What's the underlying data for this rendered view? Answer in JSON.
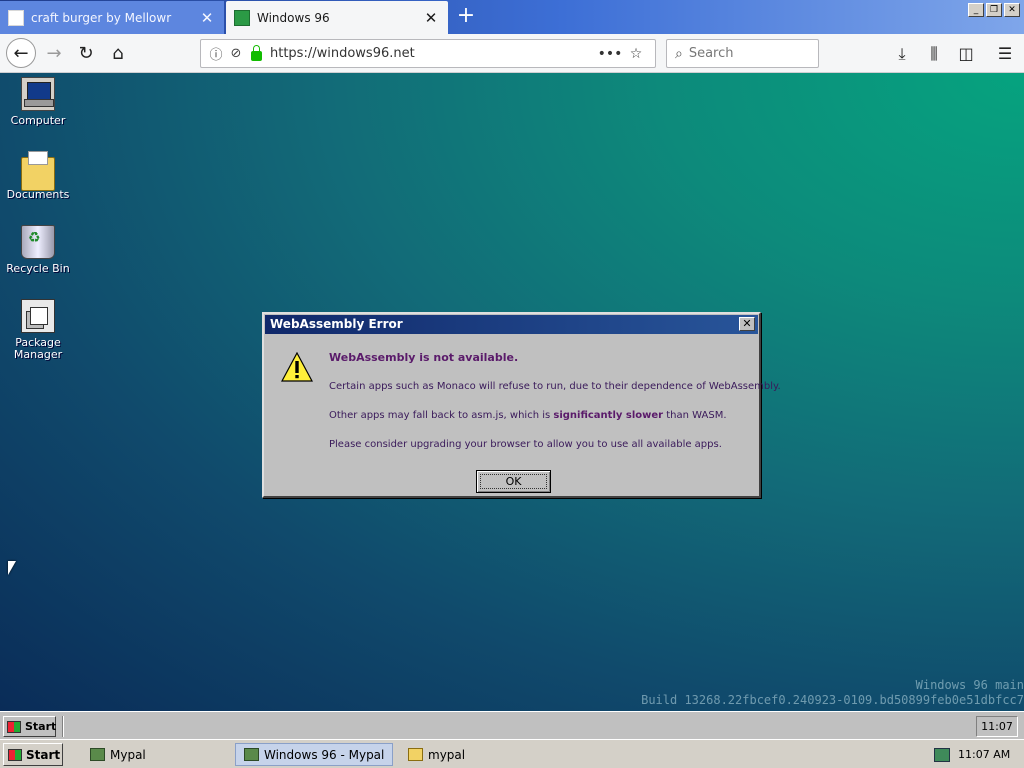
{
  "browser": {
    "tabs": [
      {
        "title": "craft burger by Mellowr",
        "active": false
      },
      {
        "title": "Windows 96",
        "active": true
      }
    ],
    "new_tab_symbol": "+",
    "close_symbol": "✕",
    "url": "https://windows96.net",
    "search_placeholder": "Search",
    "window_controls": [
      "_",
      "❐",
      "✕"
    ]
  },
  "desktop": {
    "icons": [
      {
        "label": "Computer",
        "icon": "computer-icon"
      },
      {
        "label": "Documents",
        "icon": "folder-icon"
      },
      {
        "label": "Recycle Bin",
        "icon": "recycle-bin-icon"
      },
      {
        "label": "Package Manager",
        "icon": "package-manager-icon"
      }
    ],
    "watermark_line1": "Windows 96 main",
    "watermark_line2": "Build 13268.22fbcef0.240923-0109.bd50899feb0e51dbfcc7"
  },
  "dialog": {
    "title": "WebAssembly Error",
    "heading": "WebAssembly is not available.",
    "line1": "Certain apps such as Monaco will refuse to run, due to their dependence of WebAssembly.",
    "line2_pre": "Other apps may fall back to asm.js, which is ",
    "line2_bold": "significantly slower",
    "line2_post": " than WASM.",
    "line3": "Please consider upgrading your browser to allow you to use all available apps.",
    "ok_label": "OK",
    "close_symbol": "✕"
  },
  "inner_taskbar": {
    "start_label": "Start",
    "clock": "11:07"
  },
  "host_taskbar": {
    "start_label": "Start",
    "items": [
      {
        "label": "Mypal",
        "active": false
      },
      {
        "label": "Windows 96 - Mypal",
        "active": true
      },
      {
        "label": "mypal",
        "active": false
      }
    ],
    "clock": "11:07 AM"
  },
  "colors": {
    "title_bar": "#10286a",
    "desktop_top": "#06a37f",
    "desktop_bottom": "#0a2c58",
    "dialog_text": "#5a1a6a"
  }
}
